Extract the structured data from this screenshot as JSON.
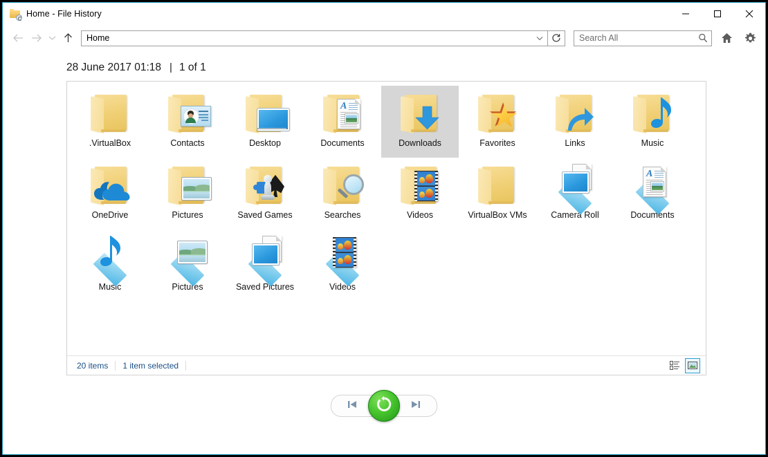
{
  "window": {
    "title": "Home - File History",
    "title_icon": "folder-history-icon",
    "controls": {
      "minimize": "minimize-icon",
      "maximize": "maximize-icon",
      "close": "close-icon"
    }
  },
  "toolbar": {
    "back": "back-arrow-icon",
    "forward": "forward-arrow-icon",
    "recent": "chevron-down-icon",
    "up": "up-arrow-icon",
    "address_value": "Home",
    "address_dropdown": "chevron-down-icon",
    "refresh": "refresh-icon",
    "search_placeholder": "Search All",
    "search_icon": "search-icon",
    "home_icon": "home-icon",
    "settings_icon": "gear-icon"
  },
  "header": {
    "timestamp": "28 June 2017 01:18",
    "separator": "|",
    "position": "1 of 1"
  },
  "items": [
    {
      "label": ".VirtualBox",
      "type": "folder",
      "emblem": "none",
      "selected": false
    },
    {
      "label": "Contacts",
      "type": "folder",
      "emblem": "contact-card",
      "selected": false
    },
    {
      "label": "Desktop",
      "type": "folder",
      "emblem": "monitor",
      "selected": false
    },
    {
      "label": "Documents",
      "type": "folder",
      "emblem": "document",
      "selected": false
    },
    {
      "label": "Downloads",
      "type": "folder",
      "emblem": "download-arrow",
      "selected": true
    },
    {
      "label": "Favorites",
      "type": "folder",
      "emblem": "star",
      "selected": false
    },
    {
      "label": "Links",
      "type": "folder",
      "emblem": "shortcut-arrow",
      "selected": false
    },
    {
      "label": "Music",
      "type": "folder",
      "emblem": "music-note",
      "selected": false
    },
    {
      "label": "OneDrive",
      "type": "folder",
      "emblem": "cloud",
      "selected": false
    },
    {
      "label": "Pictures",
      "type": "folder",
      "emblem": "picture",
      "selected": false
    },
    {
      "label": "Saved Games",
      "type": "folder",
      "emblem": "games",
      "selected": false
    },
    {
      "label": "Searches",
      "type": "folder",
      "emblem": "magnifier",
      "selected": false
    },
    {
      "label": "Videos",
      "type": "folder",
      "emblem": "film",
      "selected": false
    },
    {
      "label": "VirtualBox VMs",
      "type": "folder",
      "emblem": "none",
      "selected": false
    },
    {
      "label": "Camera Roll",
      "type": "library",
      "emblem": "picture-stack",
      "selected": false
    },
    {
      "label": "Documents",
      "type": "library",
      "emblem": "document",
      "selected": false
    },
    {
      "label": "Music",
      "type": "library",
      "emblem": "music-note",
      "selected": false
    },
    {
      "label": "Pictures",
      "type": "library",
      "emblem": "picture",
      "selected": false
    },
    {
      "label": "Saved Pictures",
      "type": "library",
      "emblem": "picture-stack",
      "selected": false
    },
    {
      "label": "Videos",
      "type": "library",
      "emblem": "film",
      "selected": false
    }
  ],
  "statusbar": {
    "item_count": "20 items",
    "selection": "1 item selected",
    "details_view_icon": "details-view-icon",
    "large_icons_view_icon": "large-icons-view-icon",
    "active_view": "large-icons"
  },
  "bottomnav": {
    "previous_icon": "skip-previous-icon",
    "restore_icon": "restore-circular-arrow-icon",
    "next_icon": "skip-next-icon"
  },
  "colors": {
    "window_border": "#1f9ec4",
    "folder_yellow": "#f0cf74",
    "library_blue": "#7fcdee",
    "restore_green": "#45c32c",
    "selection_gray": "#d6d6d6",
    "status_text_blue": "#1a4f86",
    "accent_blue": "#2a9fd6"
  }
}
